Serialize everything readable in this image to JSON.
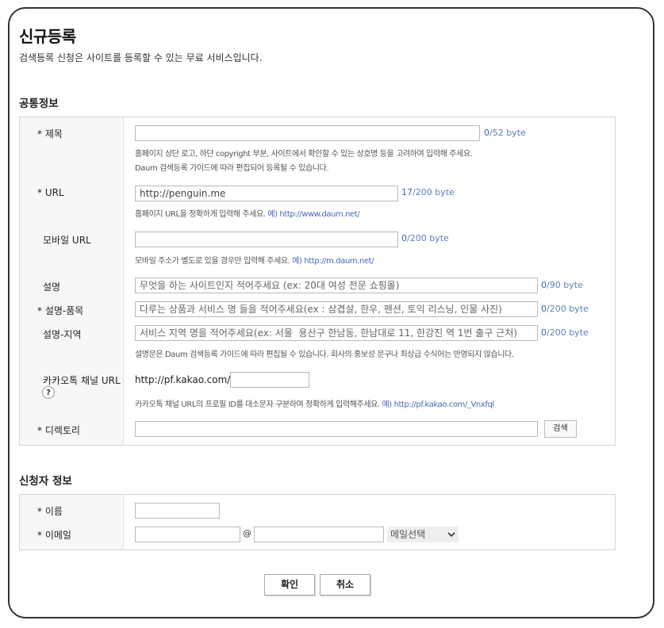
{
  "page": {
    "title": "신규등록",
    "subtitle": "검색등록 신청은 사이트를 등록할 수 있는 무료 서비스입니다."
  },
  "common": {
    "heading": "공통정보",
    "title_field": {
      "label": "* 제목",
      "value": "",
      "count": "0",
      "max": "/52 byte",
      "help1": "홈페이지 상단 로고, 하단 copyright 부분, 사이트에서 확인할 수 있는 상호명 등을 고려하여 입력해 주세요.",
      "help2": "Daum 검색등록 가이드에 따라 편집되어 등록될 수 있습니다."
    },
    "url_field": {
      "label": "* URL",
      "value": "http://penguin.me",
      "count": "17",
      "max": "/200 byte",
      "help": "홈페이지 URL을 정확하게 입력해 주세요.",
      "example": "예) http://www.daum.net/"
    },
    "mobile_field": {
      "label": "모바일 URL",
      "value": "",
      "count": "0",
      "max": "/200 byte",
      "help": "모바일 주소가 별도로 있을 경우만 입력해 주세요.",
      "example": "예) http://m.daum.net/"
    },
    "desc_field": {
      "label": "설명",
      "placeholder": "무엇을 하는 사이트인지 적어주세요 (ex: 20대 여성 전문 쇼핑몰)",
      "count": "0",
      "max": "/90 byte"
    },
    "desc_product_field": {
      "label": "* 설명-품목",
      "placeholder": "다루는 상품과 서비스 명 들을 적어주세요(ex : 삼겹살, 한우, 펜션, 토익 리스닝, 인물 사진)",
      "count": "0",
      "max": "/200 byte"
    },
    "desc_region_field": {
      "label": "설명-지역",
      "placeholder": "서비스 지역 명을 적어주세요(ex: 서울  용산구 한남동, 한남대로 11, 한강진 역 1번 출구 근처)",
      "count": "0",
      "max": "/200 byte",
      "help": "설명문은 Daum 검색등록 가이드에 따라 편집될 수 있습니다. 회사의 홍보성 문구나 최상급 수식어는 반영되지 않습니다."
    },
    "kakao_field": {
      "label": "카카오톡 채널 URL",
      "help_icon": "?",
      "prefix": "http://pf.kakao.com/",
      "value": "",
      "help": "카카오톡 채널 URL의 프로필 ID를 대소문자 구분하여 정확하게 입력해주세요.",
      "example": "예) http://pf.kakao.com/_Vnxfql"
    },
    "directory_field": {
      "label": "* 디렉토리",
      "value": "",
      "search_button": "검색"
    }
  },
  "applicant": {
    "heading": "신청자 정보",
    "name_field": {
      "label": "* 이름",
      "value": ""
    },
    "email_field": {
      "label": "* 이메일",
      "local": "",
      "at": "@",
      "domain": "",
      "select_value": "메일선택"
    }
  },
  "actions": {
    "confirm": "확인",
    "cancel": "취소"
  },
  "icons": {
    "select_arrow": "chevron-down-icon",
    "help": "question-icon"
  },
  "colors": {
    "link": "#4a6ab8",
    "count": "#5a7fbf",
    "border": "#d6d6d6"
  }
}
